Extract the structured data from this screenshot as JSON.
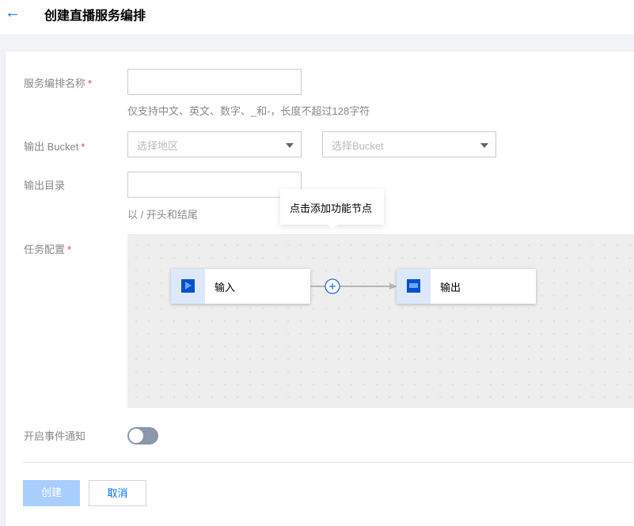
{
  "header": {
    "back_icon": "arrow-left-icon",
    "title": "创建直播服务编排"
  },
  "form": {
    "name": {
      "label": "服务编排名称",
      "required": "*",
      "value": "",
      "hint": "仅支持中文、英文、数字、_和-，长度不超过128字符"
    },
    "bucket": {
      "label": "输出 Bucket",
      "required": "*",
      "region_placeholder": "选择地区",
      "bucket_placeholder": "选择Bucket"
    },
    "dir": {
      "label": "输出目录",
      "value": "",
      "hint": "以 / 开头和结尾"
    },
    "task": {
      "label": "任务配置",
      "required": "*",
      "tooltip": "点击添加功能节点",
      "nodes": [
        {
          "label": "输入",
          "icon": "play-icon"
        },
        {
          "label": "输出",
          "icon": "output-icon"
        }
      ]
    },
    "notify": {
      "label": "开启事件通知",
      "enabled": false
    }
  },
  "actions": {
    "create": "创建",
    "cancel": "取消"
  },
  "colors": {
    "accent": "#006eff",
    "disabled_button": "#a8cdff",
    "toggle_off": "#8a97ad",
    "required": "#e54545"
  }
}
